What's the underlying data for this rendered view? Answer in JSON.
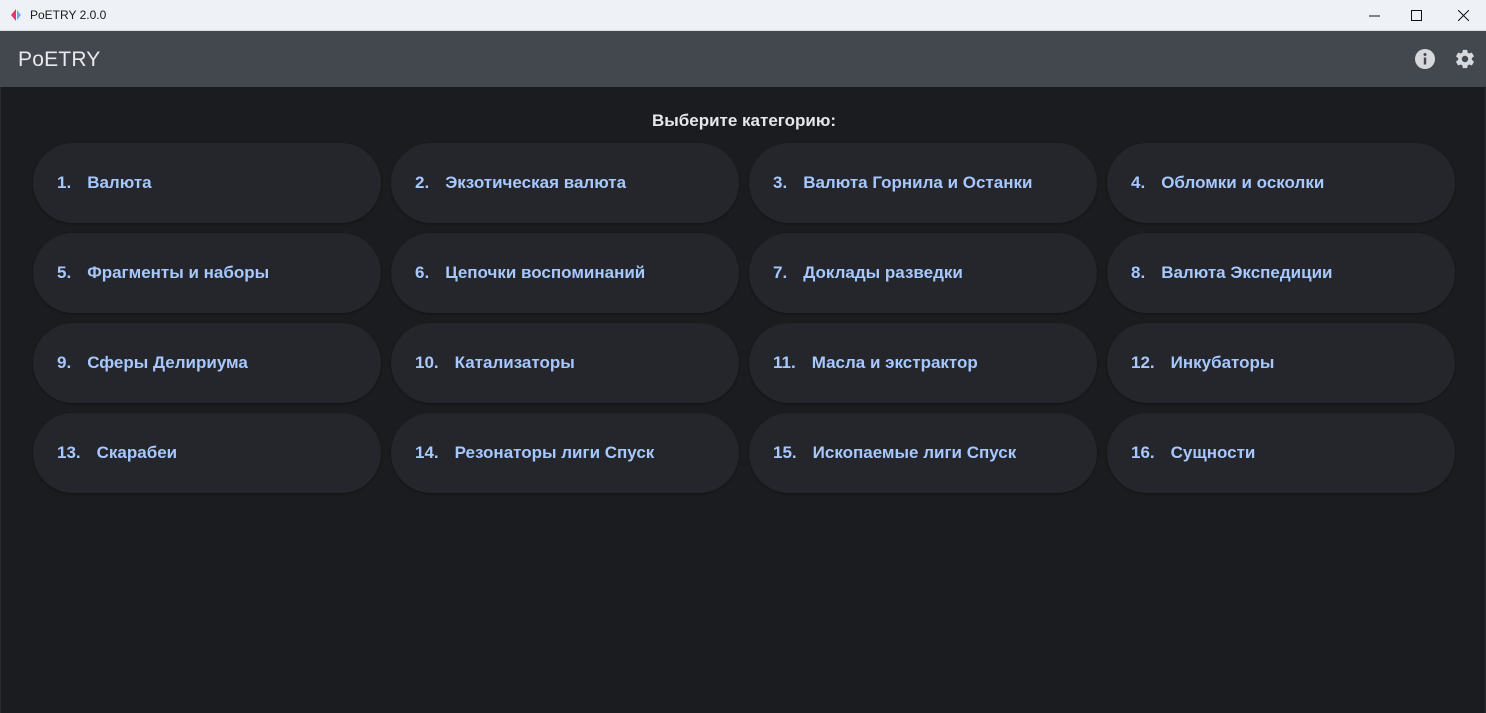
{
  "window": {
    "title": "PoETRY 2.0.0",
    "controls": {
      "minimize": "—",
      "maximize": "☐",
      "close": "✕"
    }
  },
  "appbar": {
    "title": "PoETRY",
    "icons": [
      "info-icon",
      "gear-icon"
    ]
  },
  "main": {
    "heading": "Выберите категорию:",
    "categories": [
      {
        "num": "1.",
        "label": "Валюта"
      },
      {
        "num": "2.",
        "label": "Экзотическая валюта"
      },
      {
        "num": "3.",
        "label": "Валюта Горнила и Останки"
      },
      {
        "num": "4.",
        "label": "Обломки и осколки"
      },
      {
        "num": "5.",
        "label": "Фрагменты и наборы"
      },
      {
        "num": "6.",
        "label": "Цепочки воспоминаний"
      },
      {
        "num": "7.",
        "label": "Доклады разведки"
      },
      {
        "num": "8.",
        "label": "Валюта Экспедиции"
      },
      {
        "num": "9.",
        "label": "Сферы Делириума"
      },
      {
        "num": "10.",
        "label": "Катализаторы"
      },
      {
        "num": "11.",
        "label": "Масла и экстрактор"
      },
      {
        "num": "12.",
        "label": "Инкубаторы"
      },
      {
        "num": "13.",
        "label": "Скарабеи"
      },
      {
        "num": "14.",
        "label": "Резонаторы лиги Спуск"
      },
      {
        "num": "15.",
        "label": "Ископаемые лиги Спуск"
      },
      {
        "num": "16.",
        "label": "Сущности"
      }
    ]
  },
  "colors": {
    "background": "#1b1c1f",
    "appbar": "#43474e",
    "button": "#24262b",
    "accent_text": "#a6c8ff"
  }
}
